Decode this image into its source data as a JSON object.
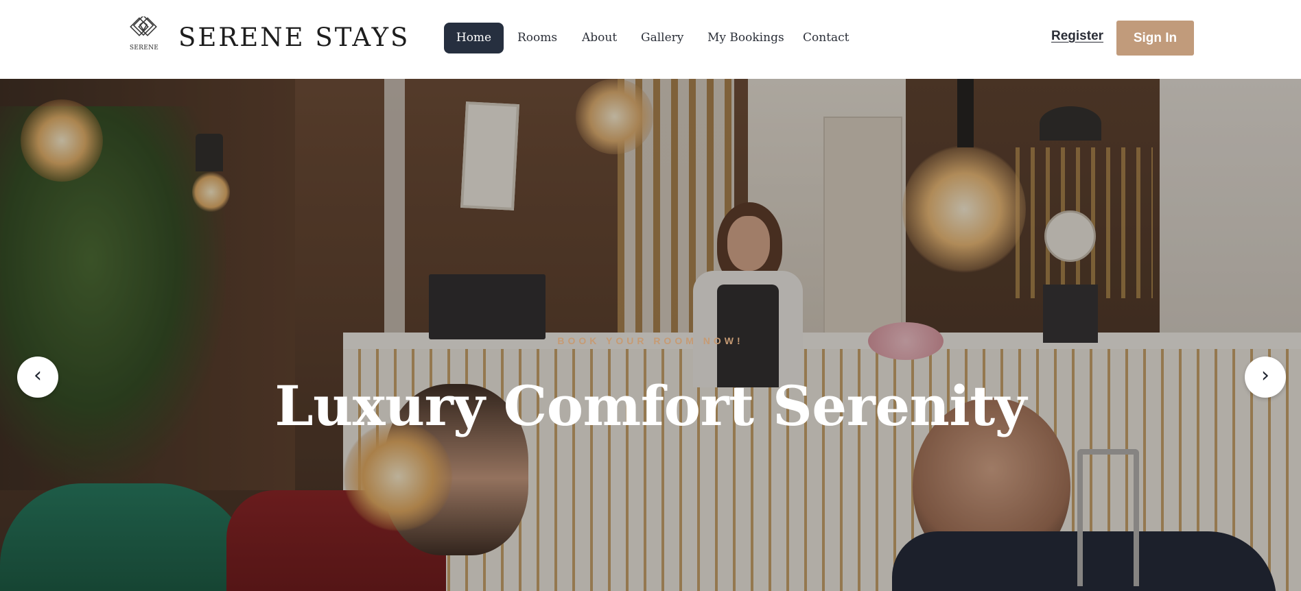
{
  "brand": {
    "logo_text": "SERENE",
    "name": "SERENE STAYS"
  },
  "nav": {
    "items": [
      {
        "label": "Home",
        "active": true
      },
      {
        "label": "Rooms",
        "active": false
      },
      {
        "label": "About",
        "active": false
      },
      {
        "label": "Gallery",
        "active": false
      },
      {
        "label": "My Bookings",
        "active": false
      },
      {
        "label": "Contact",
        "active": false
      }
    ]
  },
  "auth": {
    "register_label": "Register",
    "signin_label": "Sign In"
  },
  "hero": {
    "kicker": "BOOK YOUR ROOM NOW!",
    "headline": "Luxury Comfort Serenity",
    "prev_icon": "‹",
    "next_icon": "›"
  },
  "colors": {
    "accent": "#c19b7b",
    "nav_active_bg": "#262f3f",
    "kicker": "#c69b74"
  },
  "icons": [
    "diamond-logo-icon",
    "chevron-left-icon",
    "chevron-right-icon"
  ]
}
